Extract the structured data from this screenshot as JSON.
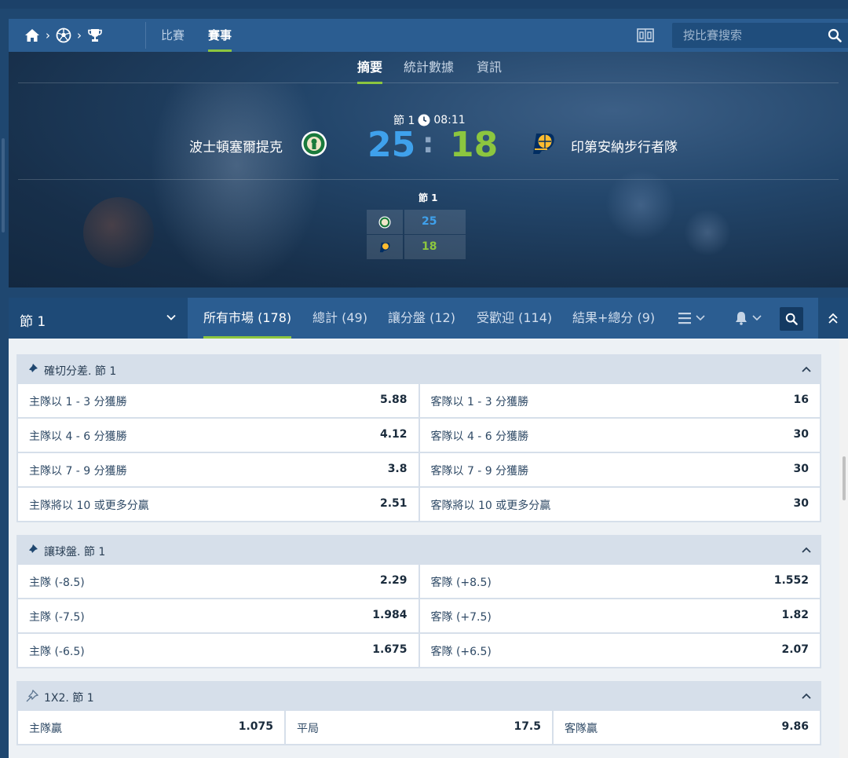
{
  "header": {
    "nav_tabs": [
      {
        "label": "比賽",
        "active": false
      },
      {
        "label": "賽事",
        "active": true
      }
    ],
    "search_placeholder": "按比賽搜索"
  },
  "event": {
    "subtabs": [
      {
        "label": "摘要",
        "active": true
      },
      {
        "label": "統計數據",
        "active": false
      },
      {
        "label": "資訊",
        "active": false
      }
    ],
    "period": "節 1",
    "clock": "08:11",
    "home_team": "波士頓塞爾提克",
    "away_team": "印第安納步行者隊",
    "home_score": "25",
    "away_score": "18",
    "separator": ":",
    "mini_header": "節 1",
    "mini_home": "25",
    "mini_away": "18",
    "colors": {
      "home": "#3fa1ec",
      "away": "#8cc63f"
    }
  },
  "market_bar": {
    "period_select": "節 1",
    "tabs": [
      {
        "label": "所有市場 (178)",
        "active": true
      },
      {
        "label": "總計 (49)",
        "active": false
      },
      {
        "label": "讓分盤 (12)",
        "active": false
      },
      {
        "label": "受歡迎 (114)",
        "active": false
      },
      {
        "label": "結果+總分 (9)",
        "active": false
      }
    ]
  },
  "markets": [
    {
      "title": "確切分差. 節 1",
      "rows": [
        [
          {
            "label": "主隊以 1 - 3 分獲勝",
            "odds": "5.88"
          },
          {
            "label": "客隊以 1 - 3 分獲勝",
            "odds": "16"
          }
        ],
        [
          {
            "label": "主隊以 4 - 6 分獲勝",
            "odds": "4.12"
          },
          {
            "label": "客隊以 4 - 6 分獲勝",
            "odds": "30"
          }
        ],
        [
          {
            "label": "主隊以 7 - 9 分獲勝",
            "odds": "3.8"
          },
          {
            "label": "客隊以 7 - 9 分獲勝",
            "odds": "30"
          }
        ],
        [
          {
            "label": "主隊將以 10 或更多分贏",
            "odds": "2.51"
          },
          {
            "label": "客隊將以 10 或更多分贏",
            "odds": "30"
          }
        ]
      ]
    },
    {
      "title": "讓球盤. 節 1",
      "rows": [
        [
          {
            "label": "主隊 (-8.5)",
            "odds": "2.29"
          },
          {
            "label": "客隊 (+8.5)",
            "odds": "1.552"
          }
        ],
        [
          {
            "label": "主隊 (-7.5)",
            "odds": "1.984"
          },
          {
            "label": "客隊 (+7.5)",
            "odds": "1.82"
          }
        ],
        [
          {
            "label": "主隊 (-6.5)",
            "odds": "1.675"
          },
          {
            "label": "客隊 (+6.5)",
            "odds": "2.07"
          }
        ]
      ]
    },
    {
      "title": "1X2. 節 1",
      "rows": [
        [
          {
            "label": "主隊贏",
            "odds": "1.075"
          },
          {
            "label": "平局",
            "odds": "17.5"
          },
          {
            "label": "客隊贏",
            "odds": "9.86"
          }
        ]
      ]
    }
  ]
}
